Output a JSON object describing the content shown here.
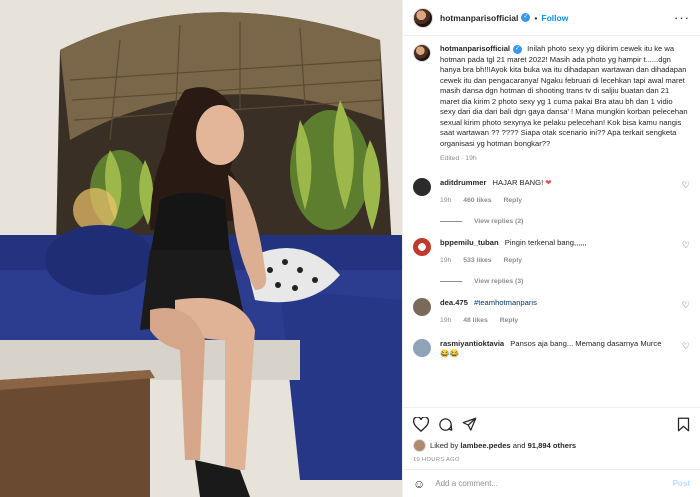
{
  "photo": {
    "alt_subject": "woman seated on blue sofa"
  },
  "header": {
    "username": "hotmanparisofficial",
    "dot": "•",
    "follow_label": "Follow",
    "more_icon": "more-horizontal-icon"
  },
  "caption": {
    "username": "hotmanparisofficial",
    "text": "Inilah photo sexy yg dikirim cewek itu ke wa hotman pada tgl 21 maret 2022! Masih ada photo yg hampir t......dgn hanya bra bh!!!Ayok kita buka wa itu dihadapan wartawan dan dihadapan cewek itu dan pengacaranya! Ngaku februari di lecehkan tapi awal maret masih dansa dgn hotman di shooting trans tv di saljiu buatan dan 21 maret dia kirim 2 photo sexy yg 1 cuma pakai Bra atau bh dan 1 vidio sexy dari dia dari bali dgn gaya dansa' ! Mana mungkin korban pelecehan sexual kirim photo sexynya ke pelaku pelecehan! Kok bisa kamu nangis saat wartawan ?? ???? Siapa otak scenario ini?? Apa terkait sengketa organisasi yg hotman bongkar??",
    "meta": "Edited · 19h"
  },
  "comments": [
    {
      "username": "aditdrummer",
      "text": "HAJAR BANG! ",
      "emoji": "❤",
      "time": "19h",
      "likes": "460 likes",
      "reply": "Reply",
      "replies": "View replies (2)",
      "avatar_color": "#2b2b2b"
    },
    {
      "username": "bppemilu_tuban",
      "text": "Pingin terkenal bang,,,,,,",
      "emoji": "",
      "time": "19h",
      "likes": "533 likes",
      "reply": "Reply",
      "replies": "View replies (3)",
      "avatar_color": "#c0392b"
    },
    {
      "username": "dea.475",
      "text": "#teamhotmanparis",
      "emoji": "",
      "time": "19h",
      "likes": "48 likes",
      "reply": "Reply",
      "replies": "",
      "avatar_color": "#7a6a5a"
    },
    {
      "username": "rasmiyantioktavia",
      "text": "Pansos aja bang... Memang dasarnya Murce",
      "emoji": "😂😂",
      "time": "",
      "likes": "",
      "reply": "",
      "replies": "",
      "avatar_color": "#8fa3b8"
    }
  ],
  "actions": {
    "like_icon": "heart-icon",
    "comment_icon": "comment-icon",
    "share_icon": "share-icon",
    "save_icon": "bookmark-icon",
    "liked_by_prefix": "Liked by ",
    "liked_by_user": "lambee.pedes",
    "liked_by_mid": " and ",
    "liked_by_count": "91,894 others",
    "timestamp": "19 HOURS AGO"
  },
  "add_comment": {
    "placeholder": "Add a comment...",
    "post_label": "Post",
    "emoji_icon": "smiley-icon"
  },
  "colors": {
    "link_blue": "#0095f6",
    "muted": "#8e8e8e",
    "text": "#262626",
    "sofa_blue": "#2c3d8f"
  }
}
